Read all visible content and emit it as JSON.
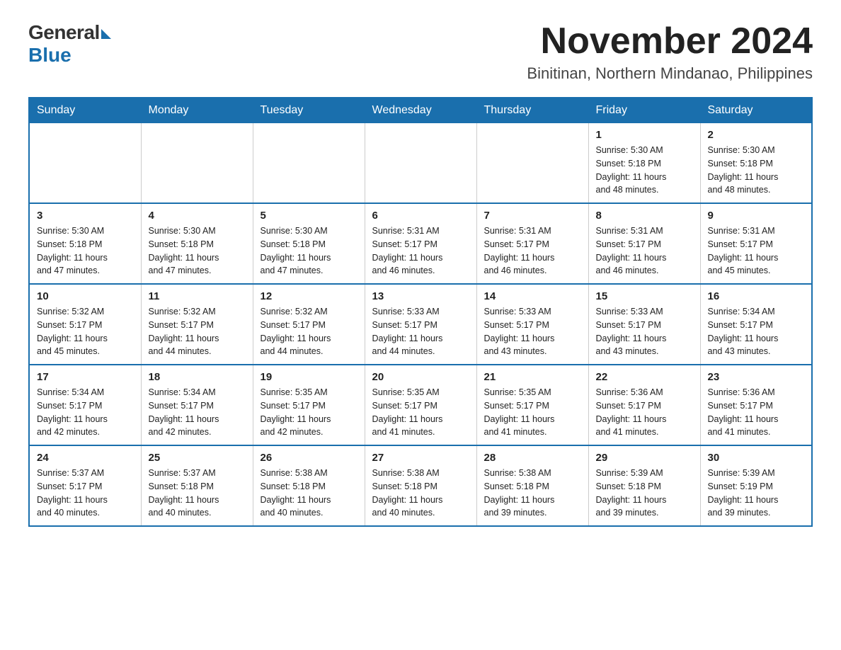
{
  "logo": {
    "general": "General",
    "blue": "Blue"
  },
  "header": {
    "month_year": "November 2024",
    "location": "Binitinan, Northern Mindanao, Philippines"
  },
  "weekdays": [
    "Sunday",
    "Monday",
    "Tuesday",
    "Wednesday",
    "Thursday",
    "Friday",
    "Saturday"
  ],
  "weeks": [
    [
      {
        "day": "",
        "info": ""
      },
      {
        "day": "",
        "info": ""
      },
      {
        "day": "",
        "info": ""
      },
      {
        "day": "",
        "info": ""
      },
      {
        "day": "",
        "info": ""
      },
      {
        "day": "1",
        "info": "Sunrise: 5:30 AM\nSunset: 5:18 PM\nDaylight: 11 hours\nand 48 minutes."
      },
      {
        "day": "2",
        "info": "Sunrise: 5:30 AM\nSunset: 5:18 PM\nDaylight: 11 hours\nand 48 minutes."
      }
    ],
    [
      {
        "day": "3",
        "info": "Sunrise: 5:30 AM\nSunset: 5:18 PM\nDaylight: 11 hours\nand 47 minutes."
      },
      {
        "day": "4",
        "info": "Sunrise: 5:30 AM\nSunset: 5:18 PM\nDaylight: 11 hours\nand 47 minutes."
      },
      {
        "day": "5",
        "info": "Sunrise: 5:30 AM\nSunset: 5:18 PM\nDaylight: 11 hours\nand 47 minutes."
      },
      {
        "day": "6",
        "info": "Sunrise: 5:31 AM\nSunset: 5:17 PM\nDaylight: 11 hours\nand 46 minutes."
      },
      {
        "day": "7",
        "info": "Sunrise: 5:31 AM\nSunset: 5:17 PM\nDaylight: 11 hours\nand 46 minutes."
      },
      {
        "day": "8",
        "info": "Sunrise: 5:31 AM\nSunset: 5:17 PM\nDaylight: 11 hours\nand 46 minutes."
      },
      {
        "day": "9",
        "info": "Sunrise: 5:31 AM\nSunset: 5:17 PM\nDaylight: 11 hours\nand 45 minutes."
      }
    ],
    [
      {
        "day": "10",
        "info": "Sunrise: 5:32 AM\nSunset: 5:17 PM\nDaylight: 11 hours\nand 45 minutes."
      },
      {
        "day": "11",
        "info": "Sunrise: 5:32 AM\nSunset: 5:17 PM\nDaylight: 11 hours\nand 44 minutes."
      },
      {
        "day": "12",
        "info": "Sunrise: 5:32 AM\nSunset: 5:17 PM\nDaylight: 11 hours\nand 44 minutes."
      },
      {
        "day": "13",
        "info": "Sunrise: 5:33 AM\nSunset: 5:17 PM\nDaylight: 11 hours\nand 44 minutes."
      },
      {
        "day": "14",
        "info": "Sunrise: 5:33 AM\nSunset: 5:17 PM\nDaylight: 11 hours\nand 43 minutes."
      },
      {
        "day": "15",
        "info": "Sunrise: 5:33 AM\nSunset: 5:17 PM\nDaylight: 11 hours\nand 43 minutes."
      },
      {
        "day": "16",
        "info": "Sunrise: 5:34 AM\nSunset: 5:17 PM\nDaylight: 11 hours\nand 43 minutes."
      }
    ],
    [
      {
        "day": "17",
        "info": "Sunrise: 5:34 AM\nSunset: 5:17 PM\nDaylight: 11 hours\nand 42 minutes."
      },
      {
        "day": "18",
        "info": "Sunrise: 5:34 AM\nSunset: 5:17 PM\nDaylight: 11 hours\nand 42 minutes."
      },
      {
        "day": "19",
        "info": "Sunrise: 5:35 AM\nSunset: 5:17 PM\nDaylight: 11 hours\nand 42 minutes."
      },
      {
        "day": "20",
        "info": "Sunrise: 5:35 AM\nSunset: 5:17 PM\nDaylight: 11 hours\nand 41 minutes."
      },
      {
        "day": "21",
        "info": "Sunrise: 5:35 AM\nSunset: 5:17 PM\nDaylight: 11 hours\nand 41 minutes."
      },
      {
        "day": "22",
        "info": "Sunrise: 5:36 AM\nSunset: 5:17 PM\nDaylight: 11 hours\nand 41 minutes."
      },
      {
        "day": "23",
        "info": "Sunrise: 5:36 AM\nSunset: 5:17 PM\nDaylight: 11 hours\nand 41 minutes."
      }
    ],
    [
      {
        "day": "24",
        "info": "Sunrise: 5:37 AM\nSunset: 5:17 PM\nDaylight: 11 hours\nand 40 minutes."
      },
      {
        "day": "25",
        "info": "Sunrise: 5:37 AM\nSunset: 5:18 PM\nDaylight: 11 hours\nand 40 minutes."
      },
      {
        "day": "26",
        "info": "Sunrise: 5:38 AM\nSunset: 5:18 PM\nDaylight: 11 hours\nand 40 minutes."
      },
      {
        "day": "27",
        "info": "Sunrise: 5:38 AM\nSunset: 5:18 PM\nDaylight: 11 hours\nand 40 minutes."
      },
      {
        "day": "28",
        "info": "Sunrise: 5:38 AM\nSunset: 5:18 PM\nDaylight: 11 hours\nand 39 minutes."
      },
      {
        "day": "29",
        "info": "Sunrise: 5:39 AM\nSunset: 5:18 PM\nDaylight: 11 hours\nand 39 minutes."
      },
      {
        "day": "30",
        "info": "Sunrise: 5:39 AM\nSunset: 5:19 PM\nDaylight: 11 hours\nand 39 minutes."
      }
    ]
  ]
}
